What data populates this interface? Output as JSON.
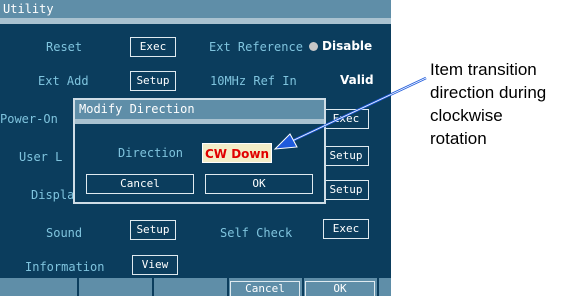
{
  "window": {
    "title": "Utility"
  },
  "rows": {
    "reset": {
      "label": "Reset",
      "button": "Exec"
    },
    "ext_reference": {
      "label": "Ext Reference",
      "value": "Disable"
    },
    "ext_add": {
      "label": "Ext Add",
      "button": "Setup"
    },
    "ref_in": {
      "label": "10MHz Ref In",
      "value": "Valid"
    },
    "power_on": {
      "label": "Power-On",
      "button": "Exec"
    },
    "user": {
      "label": "User L",
      "button": "Setup"
    },
    "display": {
      "label": "Displa",
      "button": "Setup"
    },
    "sound": {
      "label": "Sound",
      "button": "Setup"
    },
    "self_check": {
      "label": "Self Check",
      "button": "Exec"
    },
    "information": {
      "label": "Information",
      "button": "View"
    }
  },
  "dialog": {
    "title": "Modify Direction",
    "direction_label": "Direction",
    "direction_value": "CW Down",
    "cancel_label": "Cancel",
    "ok_label": "OK"
  },
  "softkeys": {
    "cancel_label": "Cancel",
    "ok_label": "OK"
  },
  "callout": {
    "lines": [
      "Item transition",
      "direction during",
      "clockwise",
      "rotation"
    ]
  },
  "colors": {
    "screen_bg": "#0b3d5d",
    "title_bar": "#5f8ea8",
    "label_text": "#7fc4de",
    "arrow": "#1e5adc",
    "direction_value_text": "#e10000"
  }
}
